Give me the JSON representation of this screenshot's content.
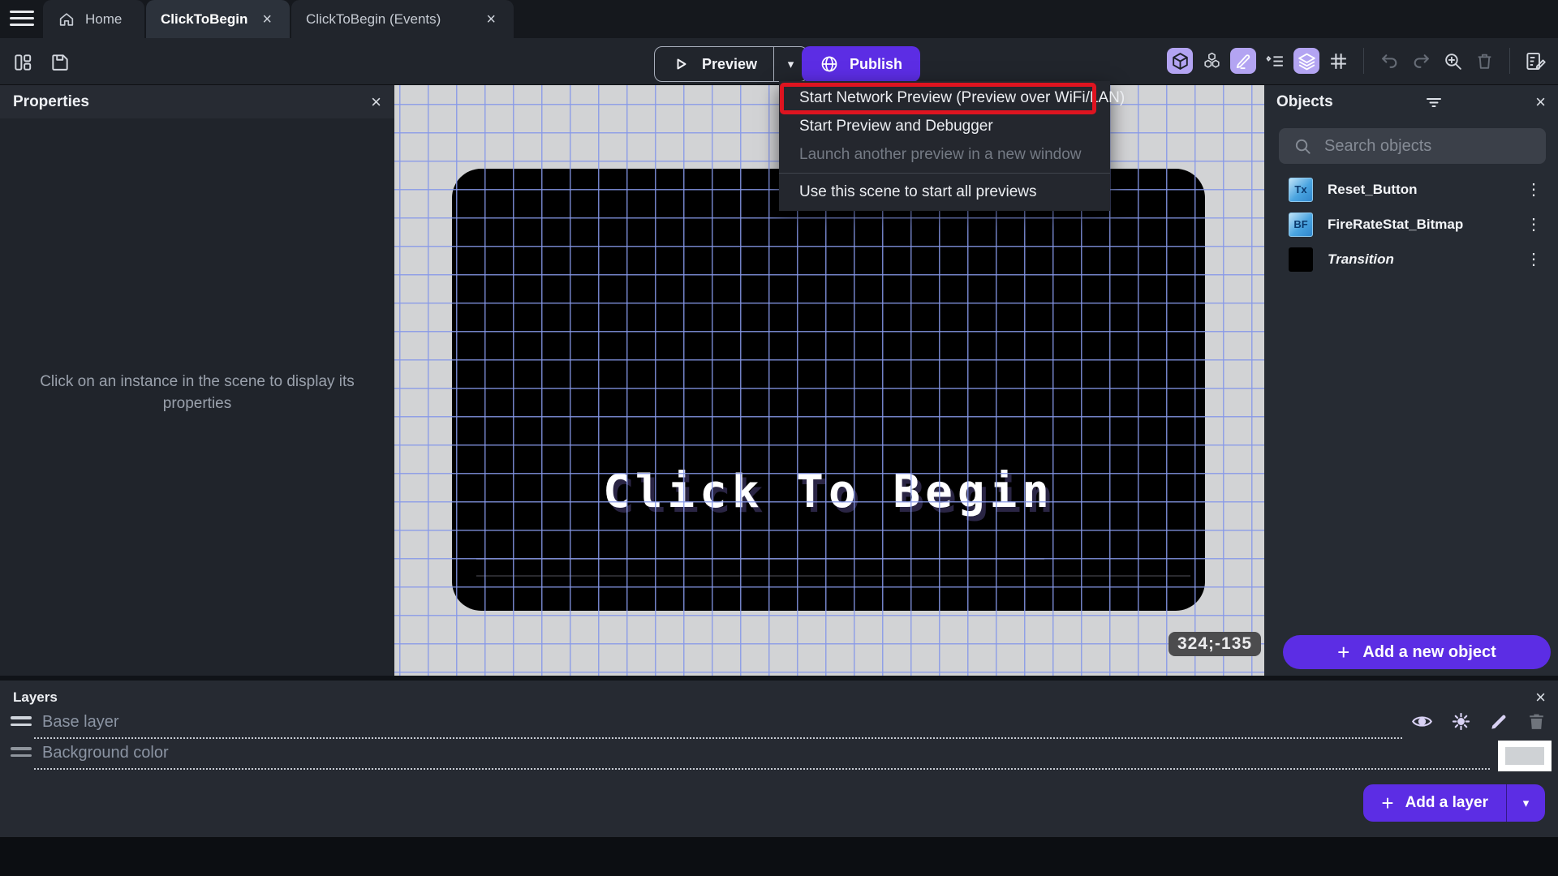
{
  "glyphs": {
    "close": "×",
    "dots": "⋮",
    "caret": "▾",
    "plus": "+"
  },
  "tabs": {
    "home": "Home",
    "scene": "ClickToBegin",
    "events": "ClickToBegin (Events)"
  },
  "toolbar": {
    "preview_label": "Preview",
    "publish_label": "Publish"
  },
  "preview_menu": {
    "items": [
      {
        "label": "Start Network Preview (Preview over WiFi/LAN)",
        "disabled": false,
        "annotated": true
      },
      {
        "label": "Start Preview and Debugger",
        "disabled": false,
        "annotated": false
      },
      {
        "label": "Launch another preview in a new window",
        "disabled": true,
        "annotated": false
      },
      {
        "label": "Use this scene to start all previews",
        "disabled": false,
        "annotated": false
      }
    ]
  },
  "properties_panel": {
    "title": "Properties",
    "empty_message": "Click on an instance in the scene to display its properties"
  },
  "scene_canvas": {
    "game_title_text": "Click To Begin",
    "cursor_coordinates": "324;-135"
  },
  "objects_panel": {
    "title": "Objects",
    "search_placeholder": "Search objects",
    "items": [
      {
        "name": "Reset_Button",
        "badge": "Tx"
      },
      {
        "name": "FireRateStat_Bitmap",
        "badge": "BF"
      },
      {
        "name": "Transition",
        "badge": ""
      }
    ],
    "add_button_label": "Add a new object"
  },
  "layers_panel": {
    "title": "Layers",
    "layers": [
      {
        "name": "Base layer"
      },
      {
        "name": "Background color"
      }
    ],
    "add_button_label": "Add a layer"
  },
  "colors": {
    "accent_purple": "#5c2de4",
    "annotation_red": "#de1420",
    "active_tool_bg": "#b3a4f2",
    "canvas_bg": "#d2d3d5",
    "grid_line": "#8698e8",
    "background_color_swatch": "#cfd2d5"
  }
}
